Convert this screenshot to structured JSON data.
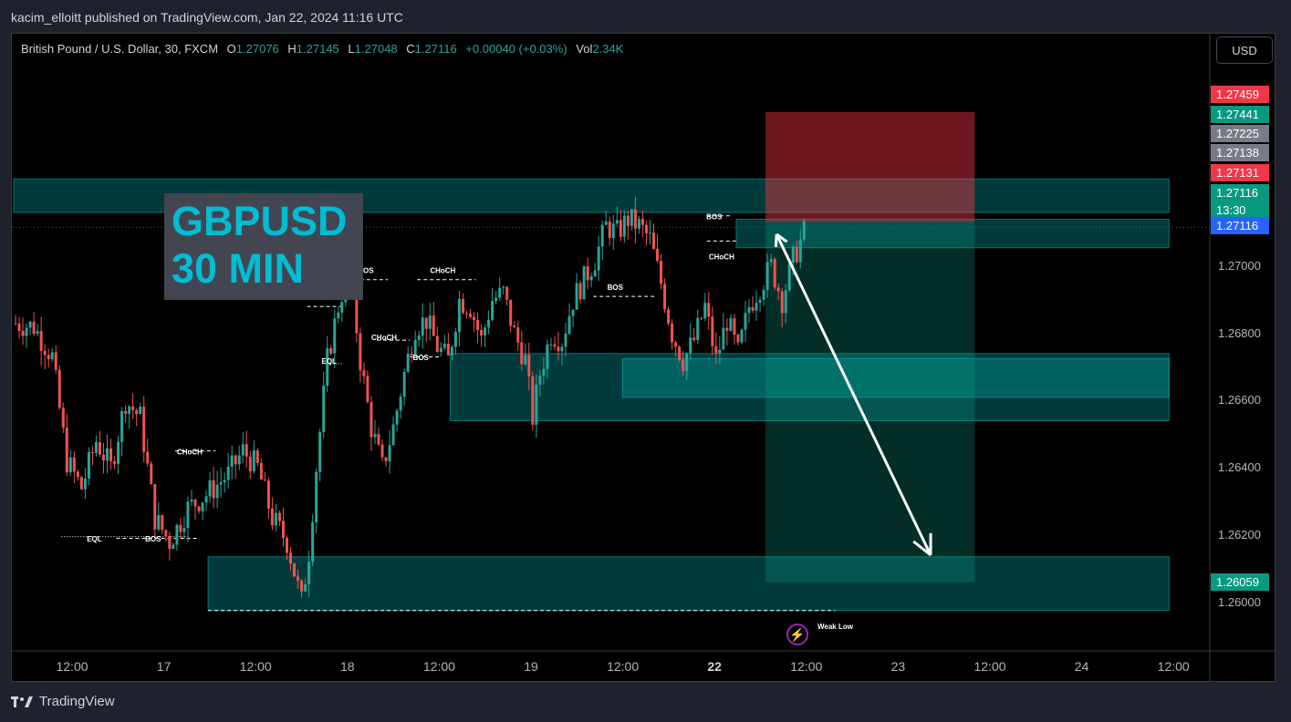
{
  "header": {
    "publisher": "kacim_elloitt published on TradingView.com, Jan 22, 2024 11:16 UTC"
  },
  "legend": {
    "symbol": "British Pound / U.S. Dollar, 30, FXCM",
    "open_label": "O",
    "open": "1.27076",
    "high_label": "H",
    "high": "1.27145",
    "low_label": "L",
    "low": "1.27048",
    "close_label": "C",
    "close": "1.27116",
    "change": "+0.00040 (+0.03%)",
    "vol_label": "Vol",
    "vol": "2.34K"
  },
  "currency_button": "USD",
  "brand": "TradingView",
  "title_box": {
    "line1": "GBPUSD",
    "line2": "30 MIN"
  },
  "colors": {
    "up": "#26a69a",
    "down": "#ef5350",
    "zone": "#00b3b3",
    "stop": "#f23645",
    "target": "#089981",
    "title_text": "#00bcd4",
    "current": "#2962ff"
  },
  "price_labels": [
    {
      "text": "1.27459",
      "price": 1.27459,
      "color": "#f23645"
    },
    {
      "text": "1.27441",
      "price": 1.27441,
      "color": "#089981"
    },
    {
      "text": "1.27225",
      "price": 1.27225,
      "color": "#787b86"
    },
    {
      "text": "1.27138",
      "price": 1.27138,
      "color": "#787b86"
    },
    {
      "text": "1.27131",
      "price": 1.27131,
      "color": "#f23645"
    },
    {
      "text": "1.27116",
      "price": 1.27116,
      "color": "#089981",
      "sub": "13:30"
    },
    {
      "text": "1.27116",
      "price": 1.27116,
      "color": "#2962ff"
    },
    {
      "text": "1.26059",
      "price": 1.26059,
      "color": "#089981"
    }
  ],
  "chart_data": {
    "type": "candlestick",
    "y_axis": {
      "min": 1.2597,
      "max": 1.2755,
      "ticks": [
        "1.27000",
        "1.26800",
        "1.26600",
        "1.26400",
        "1.26200",
        "1.26000"
      ],
      "tick_values": [
        1.27,
        1.268,
        1.266,
        1.264,
        1.262,
        1.26
      ]
    },
    "x_ticks": [
      "12:00",
      "17",
      "12:00",
      "18",
      "12:00",
      "19",
      "12:00",
      "22",
      "12:00",
      "23",
      "12:00",
      "24",
      "12:00"
    ],
    "x_tick_bold": [
      false,
      false,
      false,
      false,
      false,
      false,
      false,
      true,
      false,
      false,
      false,
      false,
      false
    ],
    "bars_total": 215,
    "candle_count": 145,
    "close_path": [
      [
        0,
        1.2683
      ],
      [
        5,
        1.2682
      ],
      [
        10,
        1.2673
      ],
      [
        14,
        1.2642
      ],
      [
        18,
        1.2634
      ],
      [
        22,
        1.2648
      ],
      [
        26,
        1.264
      ],
      [
        30,
        1.266
      ],
      [
        34,
        1.2655
      ],
      [
        38,
        1.2625
      ],
      [
        42,
        1.2618
      ],
      [
        47,
        1.2628
      ],
      [
        52,
        1.2632
      ],
      [
        58,
        1.2638
      ],
      [
        62,
        1.2645
      ],
      [
        66,
        1.264
      ],
      [
        70,
        1.2625
      ],
      [
        74,
        1.2618
      ],
      [
        78,
        1.26
      ],
      [
        80,
        1.2615
      ],
      [
        82,
        1.264
      ],
      [
        85,
        1.2672
      ],
      [
        88,
        1.2688
      ],
      [
        91,
        1.27
      ],
      [
        94,
        1.2672
      ],
      [
        97,
        1.2652
      ],
      [
        100,
        1.264
      ],
      [
        103,
        1.2652
      ],
      [
        106,
        1.2668
      ],
      [
        109,
        1.2682
      ],
      [
        112,
        1.2684
      ],
      [
        115,
        1.2676
      ],
      [
        118,
        1.2672
      ],
      [
        121,
        1.269
      ],
      [
        124,
        1.2688
      ],
      [
        127,
        1.2678
      ],
      [
        130,
        1.269
      ],
      [
        133,
        1.2692
      ],
      [
        136,
        1.268
      ],
      [
        139,
        1.2672
      ],
      [
        141,
        1.2655
      ],
      [
        143,
        1.2668
      ],
      [
        146,
        1.268
      ],
      [
        149,
        1.2678
      ],
      [
        152,
        1.269
      ],
      [
        155,
        1.2696
      ],
      [
        158,
        1.2702
      ],
      [
        161,
        1.2712
      ],
      [
        164,
        1.271
      ],
      [
        167,
        1.2714
      ],
      [
        170,
        1.2712
      ],
      [
        173,
        1.2708
      ],
      [
        176,
        1.2695
      ],
      [
        179,
        1.268
      ],
      [
        182,
        1.2672
      ],
      [
        185,
        1.2678
      ],
      [
        188,
        1.2688
      ],
      [
        191,
        1.2672
      ],
      [
        194,
        1.2684
      ],
      [
        197,
        1.2674
      ],
      [
        200,
        1.2688
      ],
      [
        203,
        1.2694
      ],
      [
        206,
        1.27
      ],
      [
        209,
        1.269
      ],
      [
        212,
        1.2702
      ],
      [
        215,
        1.271
      ],
      [
        218,
        1.2712
      ],
      [
        221,
        1.272
      ],
      [
        224,
        1.2716
      ],
      [
        227,
        1.2714
      ],
      [
        230,
        1.2712
      ],
      [
        233,
        1.2705
      ],
      [
        236,
        1.2697
      ],
      [
        239,
        1.2708
      ],
      [
        242,
        1.2712
      ]
    ],
    "zones": [
      {
        "name": "supply-zone-top",
        "x0": 0,
        "x1": 315,
        "y0": 1.2726,
        "y1": 1.2716
      },
      {
        "name": "supply-zone-small",
        "x0": 197,
        "x1": 315,
        "y0": 1.2714,
        "y1": 1.27055
      },
      {
        "name": "demand-zone-mid",
        "x0": 119,
        "x1": 315,
        "y0": 1.2674,
        "y1": 1.2654
      },
      {
        "name": "demand-zone-mid2",
        "x0": 166,
        "x1": 315,
        "y0": 1.26725,
        "y1": 1.2661
      },
      {
        "name": "demand-zone-bottom",
        "x0": 53,
        "x1": 315,
        "y0": 1.26135,
        "y1": 1.25975
      }
    ],
    "position": {
      "type": "short",
      "x0": 205,
      "x1": 262,
      "entry": 1.27116,
      "stop": 1.27459,
      "target": 1.26059,
      "stop_band": [
        1.27459,
        1.27131
      ],
      "target_band": [
        1.27131,
        1.26059
      ]
    },
    "projection": {
      "from": [
        208,
        1.27095
      ],
      "to": [
        250,
        1.2614
      ]
    },
    "annotations": [
      {
        "text": "CHoCH",
        "x": 48,
        "y": 1.2644
      },
      {
        "text": "EQL",
        "x": 22,
        "y": 1.2618
      },
      {
        "text": "BOS",
        "x": 38,
        "y": 1.2618
      },
      {
        "text": "BOS",
        "x": 84,
        "y": 1.269
      },
      {
        "text": "EQL",
        "x": 86,
        "y": 1.2671
      },
      {
        "text": "BOS",
        "x": 96,
        "y": 1.2698
      },
      {
        "text": "CHoCH",
        "x": 101,
        "y": 1.2678
      },
      {
        "text": "BOS",
        "x": 111,
        "y": 1.2672
      },
      {
        "text": "CHoCH",
        "x": 117,
        "y": 1.2698
      },
      {
        "text": "BOS",
        "x": 164,
        "y": 1.2693
      },
      {
        "text": "BOS",
        "x": 191,
        "y": 1.2714
      },
      {
        "text": "CHoCH",
        "x": 193,
        "y": 1.2702
      },
      {
        "text": "Weak Low",
        "x": 224,
        "y": 1.2592
      }
    ],
    "structure_lines": [
      {
        "x0": 13,
        "x1": 48,
        "y": 1.26195,
        "dotted": true
      },
      {
        "x0": 28,
        "x1": 50,
        "y": 1.2619,
        "dotted": false
      },
      {
        "x0": 44,
        "x1": 55,
        "y": 1.2645,
        "dotted": false
      },
      {
        "x0": 80,
        "x1": 90,
        "y": 1.2688,
        "dotted": false
      },
      {
        "x0": 84,
        "x1": 90,
        "y": 1.2671,
        "dotted": true
      },
      {
        "x0": 91,
        "x1": 102,
        "y": 1.2696,
        "dotted": false
      },
      {
        "x0": 99,
        "x1": 108,
        "y": 1.2678,
        "dotted": false
      },
      {
        "x0": 108,
        "x1": 116,
        "y": 1.2673,
        "dotted": false
      },
      {
        "x0": 110,
        "x1": 126,
        "y": 1.2696,
        "dotted": false
      },
      {
        "x0": 158,
        "x1": 175,
        "y": 1.2691,
        "dotted": false
      },
      {
        "x0": 189,
        "x1": 196,
        "y": 1.2715,
        "dotted": false
      },
      {
        "x0": 189,
        "x1": 197,
        "y": 1.27075,
        "dotted": false
      },
      {
        "x0": 53,
        "x1": 224,
        "y": 1.25975,
        "dotted": false
      }
    ],
    "grid": false,
    "xlabel": "",
    "ylabel": ""
  }
}
